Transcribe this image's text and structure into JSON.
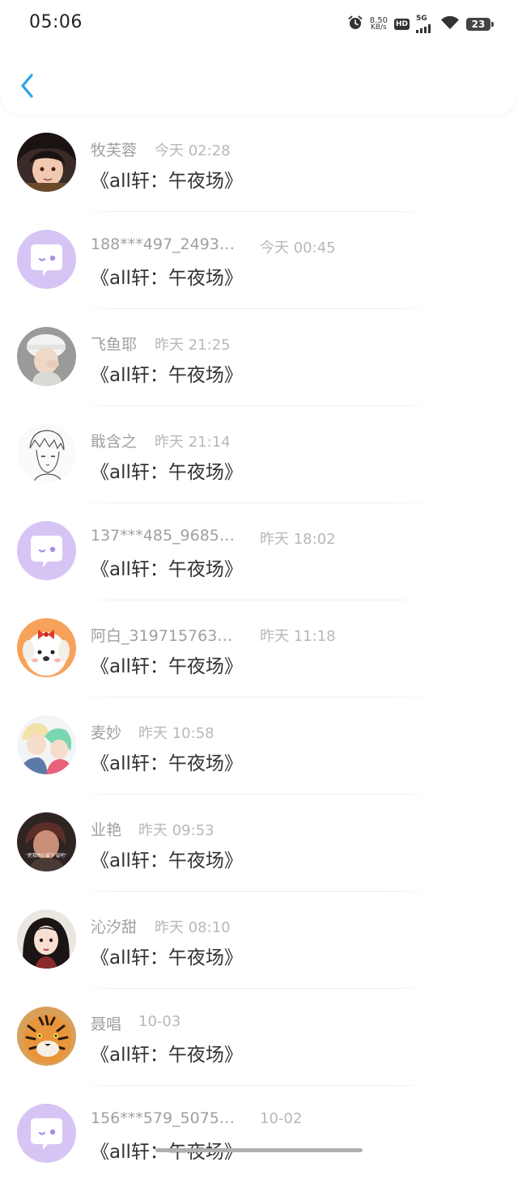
{
  "status_bar": {
    "time": "05:06",
    "net_speed_value": "8.50",
    "net_speed_unit": "KB/s",
    "hd_label": "HD",
    "signal_label": "5G",
    "battery_level": "23"
  },
  "colors": {
    "accent": "#2aa3e6",
    "username": "#a0a0a0",
    "timestamp": "#b8b8b8",
    "message": "#333333",
    "default_avatar_bg": "#d6c4f5"
  },
  "messages": [
    {
      "username": "牧芙蓉",
      "time": "今天 02:28",
      "text": "《all轩：午夜场》",
      "avatar": "anime-dark-hair"
    },
    {
      "username": "188***497_2493…",
      "time": "今天 00:45",
      "text": "《all轩：午夜场》",
      "avatar": "default-chat-bubble"
    },
    {
      "username": "飞鱼耶",
      "time": "昨天 21:25",
      "text": "《all轩：午夜场》",
      "avatar": "photo-white-hat"
    },
    {
      "username": "戢含之",
      "time": "昨天 21:14",
      "text": "《all轩：午夜场》",
      "avatar": "sketch-boy"
    },
    {
      "username": "137***485_9685…",
      "time": "昨天 18:02",
      "text": "《all轩：午夜场》",
      "avatar": "default-chat-bubble"
    },
    {
      "username": "阿白_319715763…",
      "time": "昨天 11:18",
      "text": "《all轩：午夜场》",
      "avatar": "cartoon-dog-bow"
    },
    {
      "username": "麦妙",
      "time": "昨天 10:58",
      "text": "《all轩：午夜场》",
      "avatar": "anime-couple"
    },
    {
      "username": "业艳",
      "time": "昨天 09:53",
      "text": "《all轩：午夜场》",
      "avatar": "photo-dark",
      "avatar_caption": "“把我的心留下  留吧”"
    },
    {
      "username": "沁汐甜",
      "time": "昨天 08:10",
      "text": "《all轩：午夜场》",
      "avatar": "illustrated-girl"
    },
    {
      "username": "聂唱",
      "time": "10-03",
      "text": "《all轩：午夜场》",
      "avatar": "tiger"
    },
    {
      "username": "156***579_5075…",
      "time": "10-02",
      "text": "《all轩：午夜场》",
      "avatar": "default-chat-bubble"
    }
  ]
}
